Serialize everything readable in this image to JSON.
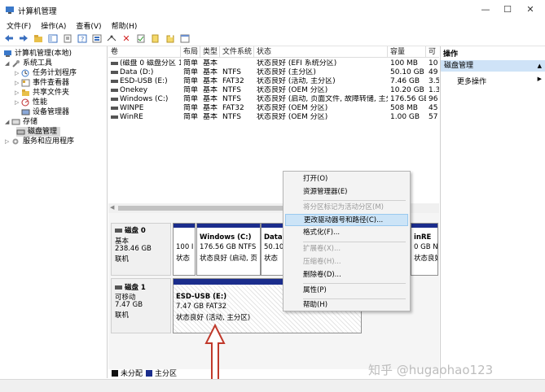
{
  "window": {
    "title": "计算机管理",
    "min": "—",
    "max": "☐",
    "close": "✕"
  },
  "menu": [
    "文件(F)",
    "操作(A)",
    "查看(V)",
    "帮助(H)"
  ],
  "tree": {
    "root": "计算机管理(本地)",
    "system_tools": "系统工具",
    "task_scheduler": "任务计划程序",
    "event_viewer": "事件查看器",
    "shared_folders": "共享文件夹",
    "performance": "性能",
    "device_manager": "设备管理器",
    "storage": "存储",
    "disk_management": "磁盘管理",
    "services": "服务和应用程序"
  },
  "table": {
    "headers": [
      "卷",
      "布局",
      "类型",
      "文件系统",
      "状态",
      "容量",
      "可"
    ],
    "rows": [
      [
        "(磁盘 0 磁盘分区 1)",
        "简单",
        "基本",
        "",
        "状态良好 (EFI 系统分区)",
        "100 MB",
        "10"
      ],
      [
        "Data (D:)",
        "简单",
        "基本",
        "NTFS",
        "状态良好 (主分区)",
        "50.10 GB",
        "49"
      ],
      [
        "ESD-USB (E:)",
        "简单",
        "基本",
        "FAT32",
        "状态良好 (活动, 主分区)",
        "7.46 GB",
        "3.5"
      ],
      [
        "Onekey",
        "简单",
        "基本",
        "NTFS",
        "状态良好 (OEM 分区)",
        "10.20 GB",
        "1.3"
      ],
      [
        "Windows (C:)",
        "简单",
        "基本",
        "NTFS",
        "状态良好 (启动, 页面文件, 故障转储, 主分区)",
        "176.56 GB",
        "96"
      ],
      [
        "WINPE",
        "简单",
        "基本",
        "FAT32",
        "状态良好 (OEM 分区)",
        "508 MB",
        "45"
      ],
      [
        "WinRE",
        "简单",
        "基本",
        "NTFS",
        "状态良好 (OEM 分区)",
        "1.00 GB",
        "57"
      ]
    ]
  },
  "disk0": {
    "name": "磁盘 0",
    "type": "基本",
    "size": "238.46 GB",
    "state": "联机",
    "p_efi_size": "100 I",
    "p_efi_status": "状态",
    "p_win_label": "Windows (C:)",
    "p_win_size": "176.56 GB NTFS",
    "p_win_status": "状态良好 (启动, 页",
    "p_data_label": "Data",
    "p_data_size": "50.10",
    "p_data_status": "状态",
    "p_re_label": "inRE",
    "p_re_size": "0 GB NTF",
    "p_re_status": "状态良好"
  },
  "disk1": {
    "name": "磁盘 1",
    "type": "可移动",
    "size": "7.47 GB",
    "state": "联机",
    "p_label": "ESD-USB (E:)",
    "p_size": "7.47 GB FAT32",
    "p_status": "状态良好 (活动, 主分区)"
  },
  "legend": {
    "unallocated": "未分配",
    "primary": "主分区"
  },
  "actions": {
    "header": "操作",
    "section": "磁盘管理",
    "more": "更多操作"
  },
  "context_menu": {
    "open": "打开(O)",
    "explorer": "资源管理器(E)",
    "mark_active": "将分区标记为活动分区(M)",
    "change_letter": "更改驱动器号和路径(C)...",
    "format": "格式化(F)...",
    "extend": "扩展卷(X)...",
    "shrink": "压缩卷(H)...",
    "delete": "删除卷(D)...",
    "properties": "属性(P)",
    "help": "帮助(H)"
  },
  "watermark": "知乎 @hugaohao123",
  "colors": {
    "partition_header": "#1b2d8c",
    "highlight": "#cce4f7",
    "arrow": "#c0392b"
  }
}
